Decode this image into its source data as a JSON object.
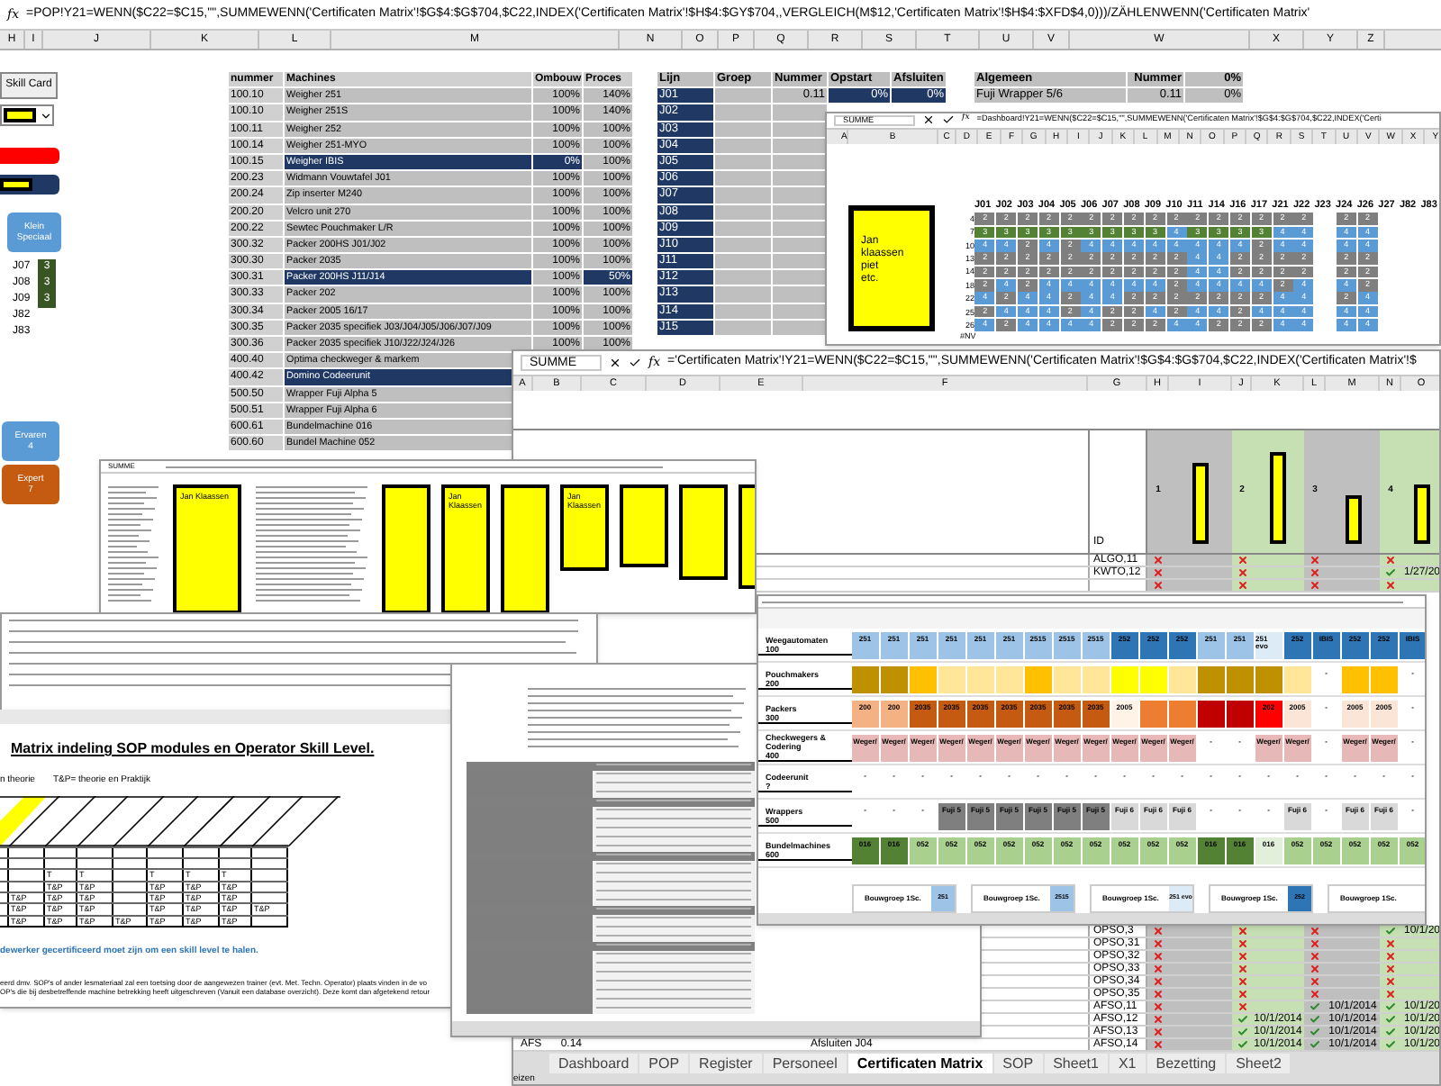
{
  "top_formula_bar": {
    "fx": "fx",
    "formula": "=POP!Y21=WENN($C22=$C15,\"\",SUMMEWENN('Certificaten Matrix'!$G$4:$G$704,$C22,INDEX('Certificaten Matrix'!$H$4:$GY$704,,VERGLEICH(M$12,'Certificaten Matrix'!$H$4:$XFD$4,0)))/ZÄHLENWENN('Certificaten Matrix'"
  },
  "columns": [
    "H",
    "I",
    "J",
    "K",
    "L",
    "M",
    "N",
    "O",
    "P",
    "Q",
    "R",
    "S",
    "T",
    "U",
    "V",
    "W",
    "X",
    "Y",
    "Z"
  ],
  "left_panel": {
    "skill_card_button": "Skill Card",
    "klein_speciaal_button": [
      "Klein",
      "Speciaal"
    ],
    "lines": [
      {
        "label": "J07",
        "value": "3"
      },
      {
        "label": "J08",
        "value": "3"
      },
      {
        "label": "J09",
        "value": "3"
      },
      {
        "label": "J82"
      },
      {
        "label": "J83"
      }
    ],
    "ervaren_button": {
      "label": "Ervaren",
      "count": "4"
    },
    "expert_button": {
      "label": "Expert",
      "count": "7"
    }
  },
  "machines_table": {
    "columns": [
      "nummer",
      "Machines",
      "Ombouw",
      "Proces"
    ],
    "rows": [
      {
        "nummer": "100.10",
        "machine": "Weigher 251",
        "ombouw": "100%",
        "proces": "140%",
        "flags": [
          false,
          false,
          false
        ]
      },
      {
        "nummer": "100.10",
        "machine": "Weigher 251S",
        "ombouw": "100%",
        "proces": "140%",
        "flags": [
          false,
          false,
          false
        ]
      },
      {
        "nummer": "100.11",
        "machine": "Weigher 252",
        "ombouw": "100%",
        "proces": "100%",
        "flags": [
          false,
          false,
          false
        ]
      },
      {
        "nummer": "100.14",
        "machine": "Weigher 251-MYO",
        "ombouw": "100%",
        "proces": "100%",
        "flags": [
          false,
          false,
          false
        ]
      },
      {
        "nummer": "100.15",
        "machine": "Weigher IBIS",
        "ombouw": "0%",
        "proces": "100%",
        "flags": [
          true,
          true,
          false
        ]
      },
      {
        "nummer": "200.23",
        "machine": "Widmann Vouwtafel J01",
        "ombouw": "100%",
        "proces": "100%",
        "flags": [
          false,
          false,
          false
        ]
      },
      {
        "nummer": "200.24",
        "machine": "Zip inserter M240",
        "ombouw": "100%",
        "proces": "100%",
        "flags": [
          false,
          false,
          false
        ]
      },
      {
        "nummer": "200.20",
        "machine": "Velcro unit 270",
        "ombouw": "100%",
        "proces": "100%",
        "flags": [
          false,
          false,
          false
        ]
      },
      {
        "nummer": "200.22",
        "machine": "Sewtec Pouchmaker L/R",
        "ombouw": "100%",
        "proces": "100%",
        "flags": [
          false,
          false,
          false
        ]
      },
      {
        "nummer": "300.32",
        "machine": "Packer 200HS J01/J02",
        "ombouw": "100%",
        "proces": "100%",
        "flags": [
          false,
          false,
          false
        ]
      },
      {
        "nummer": "300.30",
        "machine": "Packer 2035",
        "ombouw": "100%",
        "proces": "100%",
        "flags": [
          false,
          false,
          false
        ]
      },
      {
        "nummer": "300.31",
        "machine": "Packer 200HS J11/J14",
        "ombouw": "100%",
        "proces": "50%",
        "flags": [
          true,
          false,
          true
        ]
      },
      {
        "nummer": "300.33",
        "machine": "Packer 202",
        "ombouw": "100%",
        "proces": "100%",
        "flags": [
          false,
          false,
          false
        ]
      },
      {
        "nummer": "300.34",
        "machine": "Packer 2005 16/17",
        "ombouw": "100%",
        "proces": "100%",
        "flags": [
          false,
          false,
          false
        ]
      },
      {
        "nummer": "300.35",
        "machine": "Packer 2035 specifiek J03/J04/J05/J06/J07/J09",
        "ombouw": "100%",
        "proces": "100%",
        "flags": [
          false,
          false,
          false
        ]
      },
      {
        "nummer": "300.36",
        "machine": "Packer 2035 specifiek J10/J22/J24/J26",
        "ombouw": "100%",
        "proces": "100%",
        "flags": [
          false,
          false,
          false
        ]
      },
      {
        "nummer": "400.40",
        "machine": "Optima checkweger & markem",
        "flags": [
          false
        ]
      },
      {
        "nummer": "400.42",
        "machine": "Domino Codeerunit",
        "flags": [
          true
        ]
      },
      {
        "nummer": "500.50",
        "machine": "Wrapper Fuji Alpha 5",
        "flags": [
          false
        ]
      },
      {
        "nummer": "500.51",
        "machine": "Wrapper Fuji Alpha 6",
        "flags": [
          false
        ]
      },
      {
        "nummer": "600.61",
        "machine": "Bundelmachine 016",
        "flags": [
          false
        ]
      },
      {
        "nummer": "600.60",
        "machine": "Bundel Machine 052",
        "flags": [
          false
        ]
      }
    ]
  },
  "lijn_table": {
    "columns": [
      "Lijn",
      "Groep",
      "Nummer",
      "Opstart",
      "Afsluiten"
    ],
    "rows": [
      {
        "lijn": "J01",
        "nummer": "0.11",
        "opstart": "0%",
        "afsluiten": "0%"
      },
      {
        "lijn": "J02"
      },
      {
        "lijn": "J03"
      },
      {
        "lijn": "J04"
      },
      {
        "lijn": "J05"
      },
      {
        "lijn": "J06"
      },
      {
        "lijn": "J07"
      },
      {
        "lijn": "J08"
      },
      {
        "lijn": "J09"
      },
      {
        "lijn": "J10"
      },
      {
        "lijn": "J11"
      },
      {
        "lijn": "J12"
      },
      {
        "lijn": "J13"
      },
      {
        "lijn": "J14"
      },
      {
        "lijn": "J15"
      }
    ]
  },
  "algemeen_table": {
    "columns": [
      "Algemeen",
      "Nummer",
      "0%"
    ],
    "rows": [
      {
        "algemeen": "Fuji Wrapper 5/6",
        "nummer": "0.11",
        "pct": "0%"
      }
    ]
  },
  "dashboard_window": {
    "name_box": "SUMME",
    "fx": "fx",
    "formula": "=Dashboard!Y21=WENN($C22=$C15,\"\",SUMMEWENN('Certificaten Matrix'!$G$4:$G$704,$C22,INDEX('Certi",
    "columns": [
      "A",
      "B",
      "C",
      "D",
      "E",
      "F",
      "G",
      "H",
      "I",
      "J",
      "K",
      "L",
      "M",
      "N",
      "O",
      "P",
      "Q",
      "R",
      "S",
      "T",
      "U",
      "V",
      "W",
      "X",
      "Y"
    ],
    "names_note": [
      "Jan klaassen",
      "piet",
      "etc."
    ],
    "grid": {
      "columns": [
        "J01",
        "J02",
        "J03",
        "J04",
        "J05",
        "J06",
        "J07",
        "J08",
        "J09",
        "J10",
        "J11",
        "J14",
        "J16",
        "J17",
        "J21",
        "J22",
        "J23",
        "J24",
        "J26",
        "J27",
        "J82",
        "J83"
      ],
      "rows": [
        {
          "label": "4",
          "cells": [
            "2",
            "2",
            "2",
            "2",
            "2",
            "2",
            "2",
            "2",
            "2",
            "2",
            "2",
            "2",
            "2",
            "2",
            "2",
            "2",
            "",
            "2",
            "2",
            "",
            "",
            ""
          ]
        },
        {
          "label": "7",
          "cells": [
            "3",
            "3",
            "3",
            "3",
            "3",
            "3",
            "3",
            "3",
            "3",
            "4",
            "3",
            "3",
            "3",
            "3",
            "4",
            "4",
            "",
            "4",
            "4",
            "",
            "",
            ""
          ]
        },
        {
          "label": "10",
          "cells": [
            "4",
            "4",
            "2",
            "4",
            "2",
            "4",
            "4",
            "4",
            "4",
            "4",
            "4",
            "4",
            "4",
            "2",
            "4",
            "4",
            "",
            "4",
            "4",
            "",
            "",
            ""
          ]
        },
        {
          "label": "13",
          "cells": [
            "2",
            "2",
            "2",
            "2",
            "2",
            "2",
            "2",
            "2",
            "2",
            "2",
            "4",
            "4",
            "2",
            "2",
            "2",
            "2",
            "",
            "2",
            "2",
            "",
            "",
            ""
          ]
        },
        {
          "label": "14",
          "cells": [
            "2",
            "2",
            "2",
            "2",
            "2",
            "2",
            "2",
            "2",
            "2",
            "2",
            "4",
            "4",
            "2",
            "2",
            "2",
            "2",
            "",
            "2",
            "2",
            "",
            "",
            ""
          ]
        },
        {
          "label": "18",
          "cells": [
            "2",
            "4",
            "2",
            "4",
            "4",
            "4",
            "4",
            "4",
            "4",
            "2",
            "4",
            "4",
            "4",
            "4",
            "2",
            "4",
            "",
            "4",
            "2",
            "",
            "",
            ""
          ]
        },
        {
          "label": "22",
          "cells": [
            "4",
            "2",
            "4",
            "4",
            "2",
            "4",
            "4",
            "2",
            "2",
            "2",
            "2",
            "2",
            "2",
            "2",
            "4",
            "4",
            "",
            "2",
            "4",
            "",
            "",
            ""
          ]
        },
        {
          "label": "25",
          "cells": [
            "2",
            "4",
            "4",
            "4",
            "2",
            "4",
            "2",
            "2",
            "4",
            "2",
            "4",
            "4",
            "2",
            "4",
            "4",
            "4",
            "",
            "4",
            "4",
            "",
            "",
            ""
          ]
        },
        {
          "label": "26",
          "cells": [
            "4",
            "2",
            "4",
            "4",
            "4",
            "4",
            "2",
            "2",
            "2",
            "4",
            "4",
            "2",
            "2",
            "2",
            "4",
            "4",
            "",
            "4",
            "4",
            "",
            "",
            ""
          ]
        }
      ]
    },
    "error_cell": "#NV"
  },
  "certificaten_window": {
    "name_box": "SUMME",
    "fx": "fx",
    "formula": "='Certificaten Matrix'!Y21=WENN($C22=$C15,\"\",SUMMEWENN('Certificaten Matrix'!$G$4:$G$704,$C22,INDEX('Certificaten Matrix'!$",
    "columns": [
      "A",
      "B",
      "C",
      "D",
      "E",
      "F",
      "G",
      "H",
      "I",
      "J",
      "K",
      "L",
      "M",
      "N",
      "O"
    ],
    "id_header": "ID",
    "groups": [
      {
        "number": "1",
        "level": 0.75,
        "color": "#bfbfbf"
      },
      {
        "number": "2",
        "level": 0.85,
        "color": "#c6e0b4"
      },
      {
        "number": "3",
        "level": 0.45,
        "color": "#bfbfbf"
      },
      {
        "number": "4",
        "level": 0.55,
        "color": "#c6e0b4"
      }
    ],
    "rows": [
      {
        "id": "ALGO,11",
        "marks": [
          {
            "kind": "cross"
          },
          {
            "kind": "cross"
          },
          {
            "kind": "cross"
          },
          {
            "kind": "cross"
          }
        ]
      },
      {
        "id": "KWTO,12",
        "marks": [
          {
            "kind": "cross"
          },
          {
            "kind": "cross"
          },
          {
            "kind": "cross"
          },
          {
            "kind": "check",
            "date": "1/27/20"
          }
        ]
      },
      {
        "marks": [
          {
            "kind": "cross"
          },
          {
            "kind": "cross"
          },
          {
            "kind": "cross"
          },
          {
            "kind": "cross"
          }
        ]
      }
    ],
    "lower_rows": [
      {
        "id": "OPSO,3",
        "marks": [
          {
            "kind": "cross"
          },
          {
            "kind": "cross"
          },
          {
            "kind": "cross"
          },
          {
            "kind": "check",
            "date": "10/1/20"
          }
        ]
      },
      {
        "id": "OPSO,31",
        "marks": [
          {
            "kind": "cross"
          },
          {
            "kind": "cross"
          },
          {
            "kind": "cross"
          },
          {
            "kind": "cross"
          }
        ]
      },
      {
        "id": "OPSO,32",
        "marks": [
          {
            "kind": "cross"
          },
          {
            "kind": "cross"
          },
          {
            "kind": "cross"
          },
          {
            "kind": "cross"
          }
        ]
      },
      {
        "id": "OPSO,33",
        "marks": [
          {
            "kind": "cross"
          },
          {
            "kind": "cross"
          },
          {
            "kind": "cross"
          },
          {
            "kind": "cross"
          }
        ]
      },
      {
        "id": "OPSO,34",
        "marks": [
          {
            "kind": "cross"
          },
          {
            "kind": "cross"
          },
          {
            "kind": "cross"
          },
          {
            "kind": "cross"
          }
        ]
      },
      {
        "id": "OPSO,35",
        "marks": [
          {
            "kind": "cross"
          },
          {
            "kind": "cross"
          },
          {
            "kind": "cross"
          },
          {
            "kind": "cross"
          }
        ]
      },
      {
        "id": "AFSO,11",
        "marks": [
          {
            "kind": "cross"
          },
          {
            "kind": "cross"
          },
          {
            "kind": "check",
            "date": "10/1/2014"
          },
          {
            "kind": "check",
            "date": "10/1/20"
          }
        ]
      },
      {
        "id": "AFSO,12",
        "marks": [
          {
            "kind": "cross"
          },
          {
            "kind": "check",
            "date": "10/1/2014"
          },
          {
            "kind": "check",
            "date": "10/1/2014"
          },
          {
            "kind": "check",
            "date": "10/1/20"
          }
        ]
      },
      {
        "id": "AFSO,13",
        "marks": [
          {
            "kind": "cross"
          },
          {
            "kind": "check",
            "date": "10/1/2014"
          },
          {
            "kind": "check",
            "date": "10/1/2014"
          },
          {
            "kind": "check",
            "date": "10/1/20"
          }
        ]
      },
      {
        "id": "AFSO,14",
        "left_a": "AFS",
        "left_b": "0.14",
        "left_f": "Afsluiten J04",
        "marks": [
          {
            "kind": "cross"
          },
          {
            "kind": "check",
            "date": "10/1/2014"
          },
          {
            "kind": "check",
            "date": "10/1/2014"
          },
          {
            "kind": "check",
            "date": "10/1/20"
          }
        ]
      }
    ],
    "sheet_tabs": [
      {
        "label": "Dashboard",
        "selected": false
      },
      {
        "label": "POP",
        "selected": false
      },
      {
        "label": "Register",
        "selected": false
      },
      {
        "label": "Personeel",
        "selected": false
      },
      {
        "label": "Certificaten Matrix",
        "selected": true
      },
      {
        "label": "SOP",
        "selected": false
      },
      {
        "label": "Sheet1",
        "selected": false
      },
      {
        "label": "X1",
        "selected": false
      },
      {
        "label": "Bezetting",
        "selected": false
      },
      {
        "label": "Sheet2",
        "selected": false
      }
    ],
    "status": "eizen"
  },
  "filter_window": {
    "name_box": "SUMME",
    "boxes": [
      {
        "kind": "named",
        "text": "Jan Klaassen"
      },
      {
        "kind": "blank"
      },
      {
        "kind": "named",
        "text": "Jan Klaassen"
      },
      {
        "kind": "blank"
      },
      {
        "kind": "named",
        "text": "Jan Klaassen"
      },
      {
        "kind": "blank"
      },
      {
        "kind": "blank"
      },
      {
        "kind": "blank"
      }
    ]
  },
  "matrix_window": {
    "title": "Matrix indeling SOP modules en Operator Skill Level.",
    "legend": [
      "n theorie",
      "T&P= theorie en Praktijk"
    ],
    "grid": [
      [
        {
          "kind": "empty"
        },
        {
          "kind": "empty"
        },
        {
          "kind": "empty"
        },
        {
          "kind": "empty"
        },
        {
          "kind": "empty"
        },
        {
          "kind": "empty"
        },
        {
          "kind": "empty"
        },
        {
          "kind": "empty"
        },
        {
          "kind": "empty"
        }
      ],
      [
        {
          "kind": "empty"
        },
        {
          "kind": "empty"
        },
        {
          "kind": "empty"
        },
        {
          "kind": "empty"
        },
        {
          "kind": "empty"
        },
        {
          "kind": "empty"
        },
        {
          "kind": "empty"
        },
        {
          "kind": "empty"
        },
        {
          "kind": "empty"
        }
      ],
      [
        {
          "kind": "empty"
        },
        {
          "kind": "empty"
        },
        {
          "kind": "text",
          "text": "T"
        },
        {
          "kind": "text",
          "text": "T"
        },
        {
          "kind": "empty"
        },
        {
          "kind": "text",
          "text": "T"
        },
        {
          "kind": "text",
          "text": "T"
        },
        {
          "kind": "text",
          "text": "T"
        },
        {
          "kind": "empty"
        }
      ],
      [
        {
          "kind": "empty"
        },
        {
          "kind": "empty"
        },
        {
          "kind": "text",
          "text": "T&P"
        },
        {
          "kind": "text",
          "text": "T&P"
        },
        {
          "kind": "empty"
        },
        {
          "kind": "text",
          "text": "T&P"
        },
        {
          "kind": "text",
          "text": "T&P"
        },
        {
          "kind": "text",
          "text": "T&P"
        },
        {
          "kind": "empty"
        }
      ],
      [
        {
          "kind": "empty"
        },
        {
          "kind": "text",
          "text": "T&P"
        },
        {
          "kind": "text",
          "text": "T&P"
        },
        {
          "kind": "text",
          "text": "T&P"
        },
        {
          "kind": "empty"
        },
        {
          "kind": "text",
          "text": "T&P"
        },
        {
          "kind": "text",
          "text": "T&P"
        },
        {
          "kind": "text",
          "text": "T&P"
        },
        {
          "kind": "empty"
        }
      ],
      [
        {
          "kind": "empty"
        },
        {
          "kind": "text",
          "text": "T&P"
        },
        {
          "kind": "text",
          "text": "T&P"
        },
        {
          "kind": "text",
          "text": "T&P"
        },
        {
          "kind": "empty"
        },
        {
          "kind": "text",
          "text": "T&P"
        },
        {
          "kind": "text",
          "text": "T&P"
        },
        {
          "kind": "text",
          "text": "T&P"
        },
        {
          "kind": "text",
          "text": "T&P"
        }
      ],
      [
        {
          "kind": "empty"
        },
        {
          "kind": "text",
          "text": "T&P"
        },
        {
          "kind": "text",
          "text": "T&P"
        },
        {
          "kind": "text",
          "text": "T&P"
        },
        {
          "kind": "text",
          "text": "T&P"
        },
        {
          "kind": "text",
          "text": "T&P"
        },
        {
          "kind": "text",
          "text": "T&P"
        },
        {
          "kind": "text",
          "text": "T&P"
        },
        {
          "kind": "empty"
        }
      ]
    ],
    "note": "dewerker gecertificeerd moet zijn om een skill level te halen.",
    "paragraph": [
      "eerd dmv. SOP's of ander lesmateriaal zal een toetsing door de aangewezen trainer (evt. Met. Techn. Operator) plaats vinden in de vo",
      "OP's die bij desbetreffende machine betrekking heeft uitgeschreven (Vanuit een database overzicht). Deze komt dan afgetekend retour"
    ]
  },
  "bouwgroep_window": {
    "rows": [
      {
        "label": "Weegautomaten",
        "code": "100",
        "cells": [
          {
            "label": "251",
            "color": "#9dc3e6"
          },
          {
            "label": "251",
            "color": "#9dc3e6"
          },
          {
            "label": "251",
            "color": "#9dc3e6"
          },
          {
            "label": "251",
            "color": "#9dc3e6"
          },
          {
            "label": "251",
            "color": "#9dc3e6"
          },
          {
            "label": "251",
            "color": "#9dc3e6"
          },
          {
            "label": "2515",
            "color": "#9dc3e6"
          },
          {
            "label": "2515",
            "color": "#9dc3e6"
          },
          {
            "label": "2515",
            "color": "#9dc3e6"
          },
          {
            "label": "252",
            "color": "#2e75b6"
          },
          {
            "label": "252",
            "color": "#2e75b6"
          },
          {
            "label": "252",
            "color": "#2e75b6"
          },
          {
            "label": "251",
            "color": "#9dc3e6"
          },
          {
            "label": "251",
            "color": "#9dc3e6"
          },
          {
            "label": "251 evo",
            "color": "#ddebf7"
          },
          {
            "label": "252",
            "color": "#2e75b6"
          },
          {
            "label": "IBIS",
            "color": "#2e75b6"
          },
          {
            "label": "252",
            "color": "#2e75b6"
          },
          {
            "label": "252",
            "color": "#2e75b6"
          },
          {
            "label": "IBIS",
            "color": "#2e75b6"
          }
        ]
      },
      {
        "label": "Pouchmakers",
        "code": "200",
        "cells": [
          {
            "color": "#bf9000"
          },
          {
            "color": "#bf9000"
          },
          {
            "color": "#ffc000"
          },
          {
            "color": "#ffe699"
          },
          {
            "color": "#ffe699"
          },
          {
            "color": "#ffe699"
          },
          {
            "color": "#ffc000"
          },
          {
            "color": "#ffe699"
          },
          {
            "color": "#ffe699"
          },
          {
            "color": "#ffff00"
          },
          {
            "color": "#ffff00"
          },
          {
            "color": "#ffe699"
          },
          {
            "color": "#bf9000"
          },
          {
            "color": "#bf9000"
          },
          {
            "color": "#bf9000"
          },
          {
            "color": "#ffe699"
          },
          {
            "label": "-",
            "color": "#ffffff"
          },
          {
            "color": "#ffc000"
          },
          {
            "color": "#ffc000"
          },
          {
            "label": "-",
            "color": "#ffffff"
          }
        ]
      },
      {
        "label": "Packers",
        "code": "300",
        "cells": [
          {
            "label": "200",
            "color": "#f4b183"
          },
          {
            "label": "200",
            "color": "#f4b183"
          },
          {
            "label": "2035",
            "color": "#c55a11"
          },
          {
            "label": "2035",
            "color": "#c55a11"
          },
          {
            "label": "2035",
            "color": "#c55a11"
          },
          {
            "label": "2035",
            "color": "#c55a11"
          },
          {
            "label": "2035",
            "color": "#c55a11"
          },
          {
            "label": "2035",
            "color": "#c55a11"
          },
          {
            "label": "2035",
            "color": "#c55a11"
          },
          {
            "label": "2005",
            "color": "#fff2e6"
          },
          {
            "color": "#ed7d31"
          },
          {
            "color": "#ed7d31"
          },
          {
            "color": "#c00000"
          },
          {
            "color": "#c00000"
          },
          {
            "label": "202",
            "color": "#ff0000"
          },
          {
            "label": "2005",
            "color": "#fbe5d6"
          },
          {
            "label": "-",
            "color": "#ffffff"
          },
          {
            "label": "2005",
            "color": "#fbe5d6"
          },
          {
            "label": "2005",
            "color": "#fbe5d6"
          },
          {
            "label": "-",
            "color": "#ffffff"
          }
        ]
      },
      {
        "label": "Checkwegers & Codering",
        "code": "400",
        "cells": [
          {
            "label": "Weger/",
            "color": "#e6b8b7"
          },
          {
            "label": "Weger/",
            "color": "#e6b8b7"
          },
          {
            "label": "Weger/",
            "color": "#e6b8b7"
          },
          {
            "label": "Weger/",
            "color": "#e6b8b7"
          },
          {
            "label": "Weger/",
            "color": "#e6b8b7"
          },
          {
            "label": "Weger/",
            "color": "#e6b8b7"
          },
          {
            "label": "Weger/",
            "color": "#e6b8b7"
          },
          {
            "label": "Weger/",
            "color": "#e6b8b7"
          },
          {
            "label": "Weger/",
            "color": "#e6b8b7"
          },
          {
            "label": "Weger/",
            "color": "#e6b8b7"
          },
          {
            "label": "Weger/",
            "color": "#e6b8b7"
          },
          {
            "label": "Weger/",
            "color": "#e6b8b7"
          },
          {
            "label": "-",
            "color": "#ffffff"
          },
          {
            "label": "-",
            "color": "#ffffff"
          },
          {
            "label": "Weger/",
            "color": "#e6b8b7"
          },
          {
            "label": "Weger/",
            "color": "#e6b8b7"
          },
          {
            "label": "-",
            "color": "#ffffff"
          },
          {
            "label": "Weger/",
            "color": "#e6b8b7"
          },
          {
            "label": "Weger/",
            "color": "#e6b8b7"
          },
          {
            "label": "-",
            "color": "#ffffff"
          }
        ]
      },
      {
        "label": "Codeerunit",
        "code": "?",
        "cells": [
          {
            "label": "-",
            "color": "#ffffff"
          },
          {
            "label": "-",
            "color": "#ffffff"
          },
          {
            "label": "-",
            "color": "#ffffff"
          },
          {
            "label": "-",
            "color": "#ffffff"
          },
          {
            "label": "-",
            "color": "#ffffff"
          },
          {
            "label": "-",
            "color": "#ffffff"
          },
          {
            "label": "-",
            "color": "#ffffff"
          },
          {
            "label": "-",
            "color": "#ffffff"
          },
          {
            "label": "-",
            "color": "#ffffff"
          },
          {
            "label": "-",
            "color": "#ffffff"
          },
          {
            "label": "-",
            "color": "#ffffff"
          },
          {
            "label": "-",
            "color": "#ffffff"
          },
          {
            "label": "-",
            "color": "#ffffff"
          },
          {
            "label": "-",
            "color": "#ffffff"
          },
          {
            "label": "-",
            "color": "#ffffff"
          },
          {
            "label": "-",
            "color": "#ffffff"
          },
          {
            "label": "-",
            "color": "#ffffff"
          },
          {
            "label": "-",
            "color": "#ffffff"
          },
          {
            "label": "-",
            "color": "#ffffff"
          },
          {
            "label": "-",
            "color": "#ffffff"
          }
        ]
      },
      {
        "label": "Wrappers",
        "code": "500",
        "cells": [
          {
            "label": "-",
            "color": "#ffffff"
          },
          {
            "label": "-",
            "color": "#ffffff"
          },
          {
            "label": "-",
            "color": "#ffffff"
          },
          {
            "label": "Fuji 5",
            "color": "#7f7f7f"
          },
          {
            "label": "Fuji 5",
            "color": "#7f7f7f"
          },
          {
            "label": "Fuji 5",
            "color": "#7f7f7f"
          },
          {
            "label": "Fuji 5",
            "color": "#7f7f7f"
          },
          {
            "label": "Fuji 5",
            "color": "#7f7f7f"
          },
          {
            "label": "Fuji 5",
            "color": "#7f7f7f"
          },
          {
            "label": "Fuji 6",
            "color": "#d9d9d9"
          },
          {
            "label": "Fuji 6",
            "color": "#d9d9d9"
          },
          {
            "label": "Fuji 6",
            "color": "#d9d9d9"
          },
          {
            "label": "-",
            "color": "#ffffff"
          },
          {
            "label": "-",
            "color": "#ffffff"
          },
          {
            "label": "-",
            "color": "#ffffff"
          },
          {
            "label": "Fuji 6",
            "color": "#d9d9d9"
          },
          {
            "label": "-",
            "color": "#ffffff"
          },
          {
            "label": "Fuji 6",
            "color": "#d9d9d9"
          },
          {
            "label": "Fuji 6",
            "color": "#d9d9d9"
          },
          {
            "label": "-",
            "color": "#ffffff"
          }
        ]
      },
      {
        "label": "Bundelmachines",
        "code": "600",
        "cells": [
          {
            "label": "016",
            "color": "#548235"
          },
          {
            "label": "016",
            "color": "#548235"
          },
          {
            "label": "052",
            "color": "#a9d08e"
          },
          {
            "label": "052",
            "color": "#a9d08e"
          },
          {
            "label": "052",
            "color": "#a9d08e"
          },
          {
            "label": "052",
            "color": "#a9d08e"
          },
          {
            "label": "052",
            "color": "#a9d08e"
          },
          {
            "label": "052",
            "color": "#a9d08e"
          },
          {
            "label": "052",
            "color": "#a9d08e"
          },
          {
            "label": "052",
            "color": "#a9d08e"
          },
          {
            "label": "052",
            "color": "#a9d08e"
          },
          {
            "label": "052",
            "color": "#a9d08e"
          },
          {
            "label": "016",
            "color": "#548235"
          },
          {
            "label": "016",
            "color": "#548235"
          },
          {
            "label": "016",
            "color": "#e2efda"
          },
          {
            "label": "052",
            "color": "#a9d08e"
          },
          {
            "label": "052",
            "color": "#a9d08e"
          },
          {
            "label": "052",
            "color": "#a9d08e"
          },
          {
            "label": "052",
            "color": "#a9d08e"
          },
          {
            "label": "052",
            "color": "#a9d08e"
          }
        ]
      }
    ],
    "bouwgroep_boxes": [
      {
        "label": "Bouwgroep 1Sc.",
        "code": "251",
        "color": "#9dc3e6"
      },
      {
        "label": "Bouwgroep 1Sc.",
        "code": "2515",
        "color": "#9dc3e6"
      },
      {
        "label": "Bouwgroep 1Sc.",
        "code": "251 evo",
        "color": "#ddebf7"
      },
      {
        "label": "Bouwgroep 1Sc.",
        "code": "252",
        "color": "#2e75b6"
      },
      {
        "label": "Bouwgroep 1Sc."
      }
    ]
  }
}
